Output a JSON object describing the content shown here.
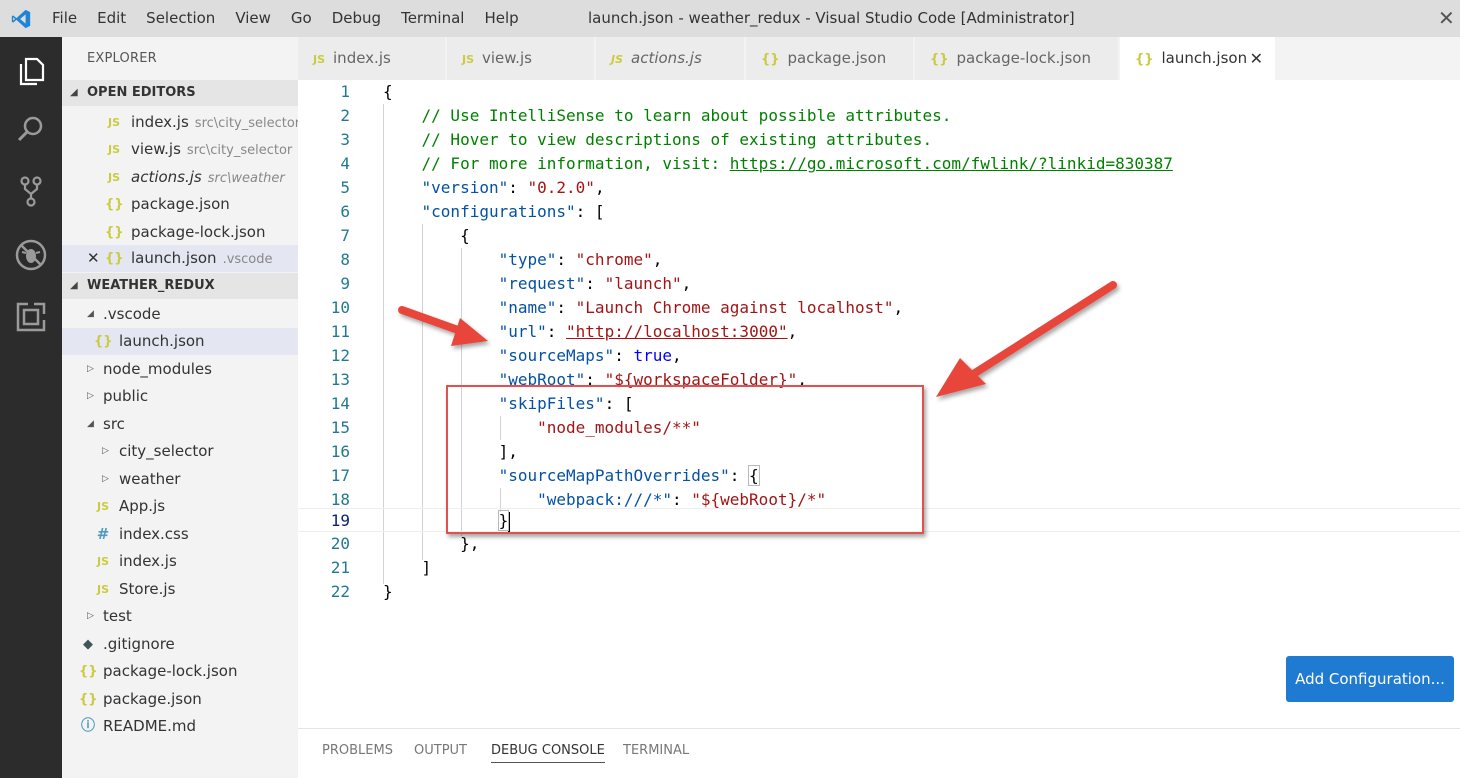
{
  "window": {
    "title": "launch.json - weather_redux - Visual Studio Code [Administrator]",
    "menu": [
      "File",
      "Edit",
      "Selection",
      "View",
      "Go",
      "Debug",
      "Terminal",
      "Help"
    ]
  },
  "sidebar": {
    "header": "EXPLORER",
    "open_editors": {
      "title": "OPEN EDITORS",
      "items": [
        {
          "icon": "JS",
          "name": "index.js",
          "desc": "src\\city_selector"
        },
        {
          "icon": "JS",
          "name": "view.js",
          "desc": "src\\city_selector"
        },
        {
          "icon": "JS",
          "name": "actions.js",
          "desc": "src\\weather"
        },
        {
          "icon": "{}",
          "name": "package.json",
          "desc": ""
        },
        {
          "icon": "{}",
          "name": "package-lock.json",
          "desc": ""
        },
        {
          "icon": "{}",
          "name": "launch.json",
          "desc": ".vscode"
        }
      ]
    },
    "project": {
      "title": "WEATHER_REDUX",
      "items": [
        {
          "icon": "",
          "name": ".vscode"
        },
        {
          "icon": "{}",
          "name": "launch.json"
        },
        {
          "icon": "",
          "name": "node_modules"
        },
        {
          "icon": "",
          "name": "public"
        },
        {
          "icon": "",
          "name": "src"
        },
        {
          "icon": "",
          "name": "city_selector"
        },
        {
          "icon": "",
          "name": "weather"
        },
        {
          "icon": "JS",
          "name": "App.js"
        },
        {
          "icon": "#",
          "name": "index.css"
        },
        {
          "icon": "JS",
          "name": "index.js"
        },
        {
          "icon": "JS",
          "name": "Store.js"
        },
        {
          "icon": "",
          "name": "test"
        },
        {
          "icon": "◆",
          "name": ".gitignore"
        },
        {
          "icon": "{}",
          "name": "package-lock.json"
        },
        {
          "icon": "{}",
          "name": "package.json"
        },
        {
          "icon": "ⓘ",
          "name": "README.md"
        }
      ]
    }
  },
  "tabs": [
    {
      "icon": "JS",
      "label": "index.js"
    },
    {
      "icon": "JS",
      "label": "view.js"
    },
    {
      "icon": "JS",
      "label": "actions.js"
    },
    {
      "icon": "{}",
      "label": "package.json"
    },
    {
      "icon": "{}",
      "label": "package-lock.json"
    },
    {
      "icon": "{}",
      "label": "launch.json"
    }
  ],
  "editor": {
    "line_numbers": [
      "1",
      "2",
      "3",
      "4",
      "5",
      "6",
      "7",
      "8",
      "9",
      "10",
      "11",
      "12",
      "13",
      "14",
      "15",
      "16",
      "17",
      "18",
      "19",
      "20",
      "21",
      "22"
    ],
    "code": {
      "l1": "{",
      "l2": "// Use IntelliSense to learn about possible attributes.",
      "l3": "// Hover to view descriptions of existing attributes.",
      "l4_prefix": "// For more information, visit: ",
      "l4_link": "https://go.microsoft.com/fwlink/?linkid=830387",
      "version_key": "\"version\"",
      "version_val": "\"0.2.0\"",
      "configurations_key": "\"configurations\"",
      "type_key": "\"type\"",
      "type_val": "\"chrome\"",
      "request_key": "\"request\"",
      "request_val": "\"launch\"",
      "name_key": "\"name\"",
      "name_val": "\"Launch Chrome against localhost\"",
      "url_key": "\"url\"",
      "url_val_open": "\"",
      "url_val_link": "http://localhost:3000",
      "url_val_close": "\"",
      "sourcemaps_key": "\"sourceMaps\"",
      "sourcemaps_val": "true",
      "webroot_key": "\"webRoot\"",
      "webroot_val": "\"${workspaceFolder}\"",
      "skipfiles_key": "\"skipFiles\"",
      "skipfiles_item": "\"node_modules/**\"",
      "smpo_key": "\"sourceMapPathOverrides\"",
      "webpack_key": "\"webpack:///*\"",
      "webpack_val": "\"${webRoot}/*\""
    }
  },
  "add_config_label": "Add Configuration...",
  "panel_tabs": [
    "PROBLEMS",
    "OUTPUT",
    "DEBUG CONSOLE",
    "TERMINAL"
  ],
  "colors": {
    "accent": "#1f7ad1",
    "annotation": "#e05252",
    "activity_bar": "#2c2c2c"
  }
}
